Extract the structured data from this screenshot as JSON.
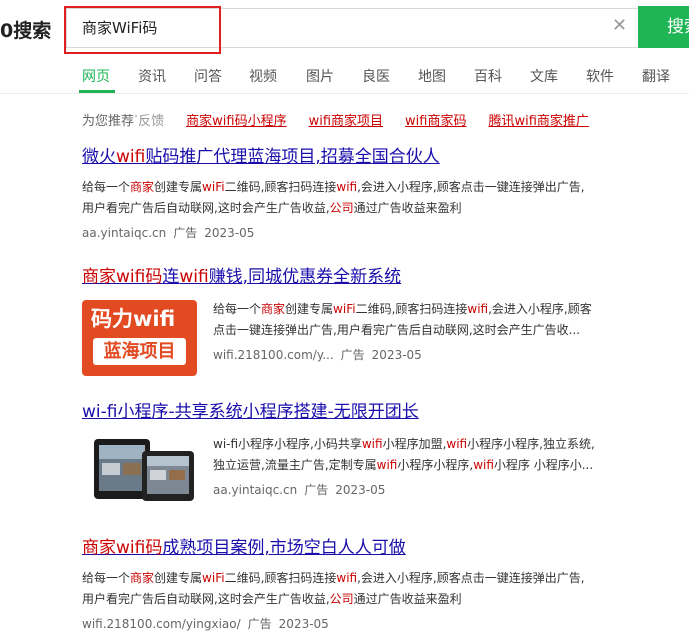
{
  "logo": "0搜索",
  "search": {
    "query": "商家WiFi码",
    "button_label": "搜索",
    "clear_icon": "close-icon"
  },
  "tabs": [
    "网页",
    "资讯",
    "问答",
    "视频",
    "图片",
    "良医",
    "地图",
    "百科",
    "文库",
    "软件",
    "翻译"
  ],
  "recommend": {
    "label": "为您推荐",
    "sep": " · ",
    "feedback": "反馈",
    "links": [
      "商家wifi码小程序",
      "wifi商家项目",
      "wifi商家码",
      "腾讯wifi商家推广"
    ]
  },
  "results": [
    {
      "title_parts": [
        "微火",
        "wifi",
        "贴码推广代理蓝海项目,招募全国合伙人"
      ],
      "desc_line1": [
        "给每一个",
        "商家",
        "创建专属",
        "wiFi",
        "二维码,顾客扫码连接",
        "wifi",
        ",会进入小程序,顾客点击一键连接弹出广告,"
      ],
      "desc_line2": [
        "用户看完广告后自动联网,这时会产生广告收益,",
        "公司",
        "通过广告收益来盈利"
      ],
      "url": "aa.yintaiqc.cn",
      "ad": "广告",
      "date": "2023-05"
    },
    {
      "title_parts": [
        "商家",
        "wifi",
        "码",
        "连",
        "wifi",
        "赚钱,同城优惠券全新系统"
      ],
      "thumb_line1": "码力wifi",
      "thumb_line2": "蓝海项目",
      "desc_line1": [
        "给每一个",
        "商家",
        "创建专属",
        "wiFi",
        "二维码,顾客扫码连接",
        "wifi",
        ",会进入小程序,顾客"
      ],
      "desc_line2": "点击一键连接弹出广告,用户看完广告后自动联网,这时会产生广告收...",
      "url": "wifi.218100.com/y...",
      "ad": "广告",
      "date": "2023-05"
    },
    {
      "title": "wi-fi小程序-共享系统小程序搭建-无限开团长",
      "desc_line1": [
        "wi-fi小程序小程序,小码共享",
        "wifi",
        "小程序加盟,",
        "wifi",
        "小程序小程序,独立系统,"
      ],
      "desc_line2": [
        "独立运营,流量主广告,定制专属",
        "wifi",
        "小程序小程序,",
        "wifi",
        "小程序 小程序小..."
      ],
      "url": "aa.yintaiqc.cn",
      "ad": "广告",
      "date": "2023-05"
    },
    {
      "title_parts": [
        "商家",
        "wifi",
        "码",
        "成熟项目案例,市场空白人人可做"
      ],
      "desc_line1": [
        "给每一个",
        "商家",
        "创建专属",
        "wiFi",
        "二维码,顾客扫码连接",
        "wifi",
        ",会进入小程序,顾客点击一键连接弹出广告,"
      ],
      "desc_line2": [
        "用户看完广告后自动联网,这时会产生广告收益,",
        "公司",
        "通过广告收益来盈利"
      ],
      "url": "wifi.218100.com/yingxiao/",
      "ad": "广告",
      "date": "2023-05"
    }
  ],
  "colors": {
    "accent": "#1fb555",
    "highlight": "#cc0000",
    "link": "#1a0dab"
  }
}
